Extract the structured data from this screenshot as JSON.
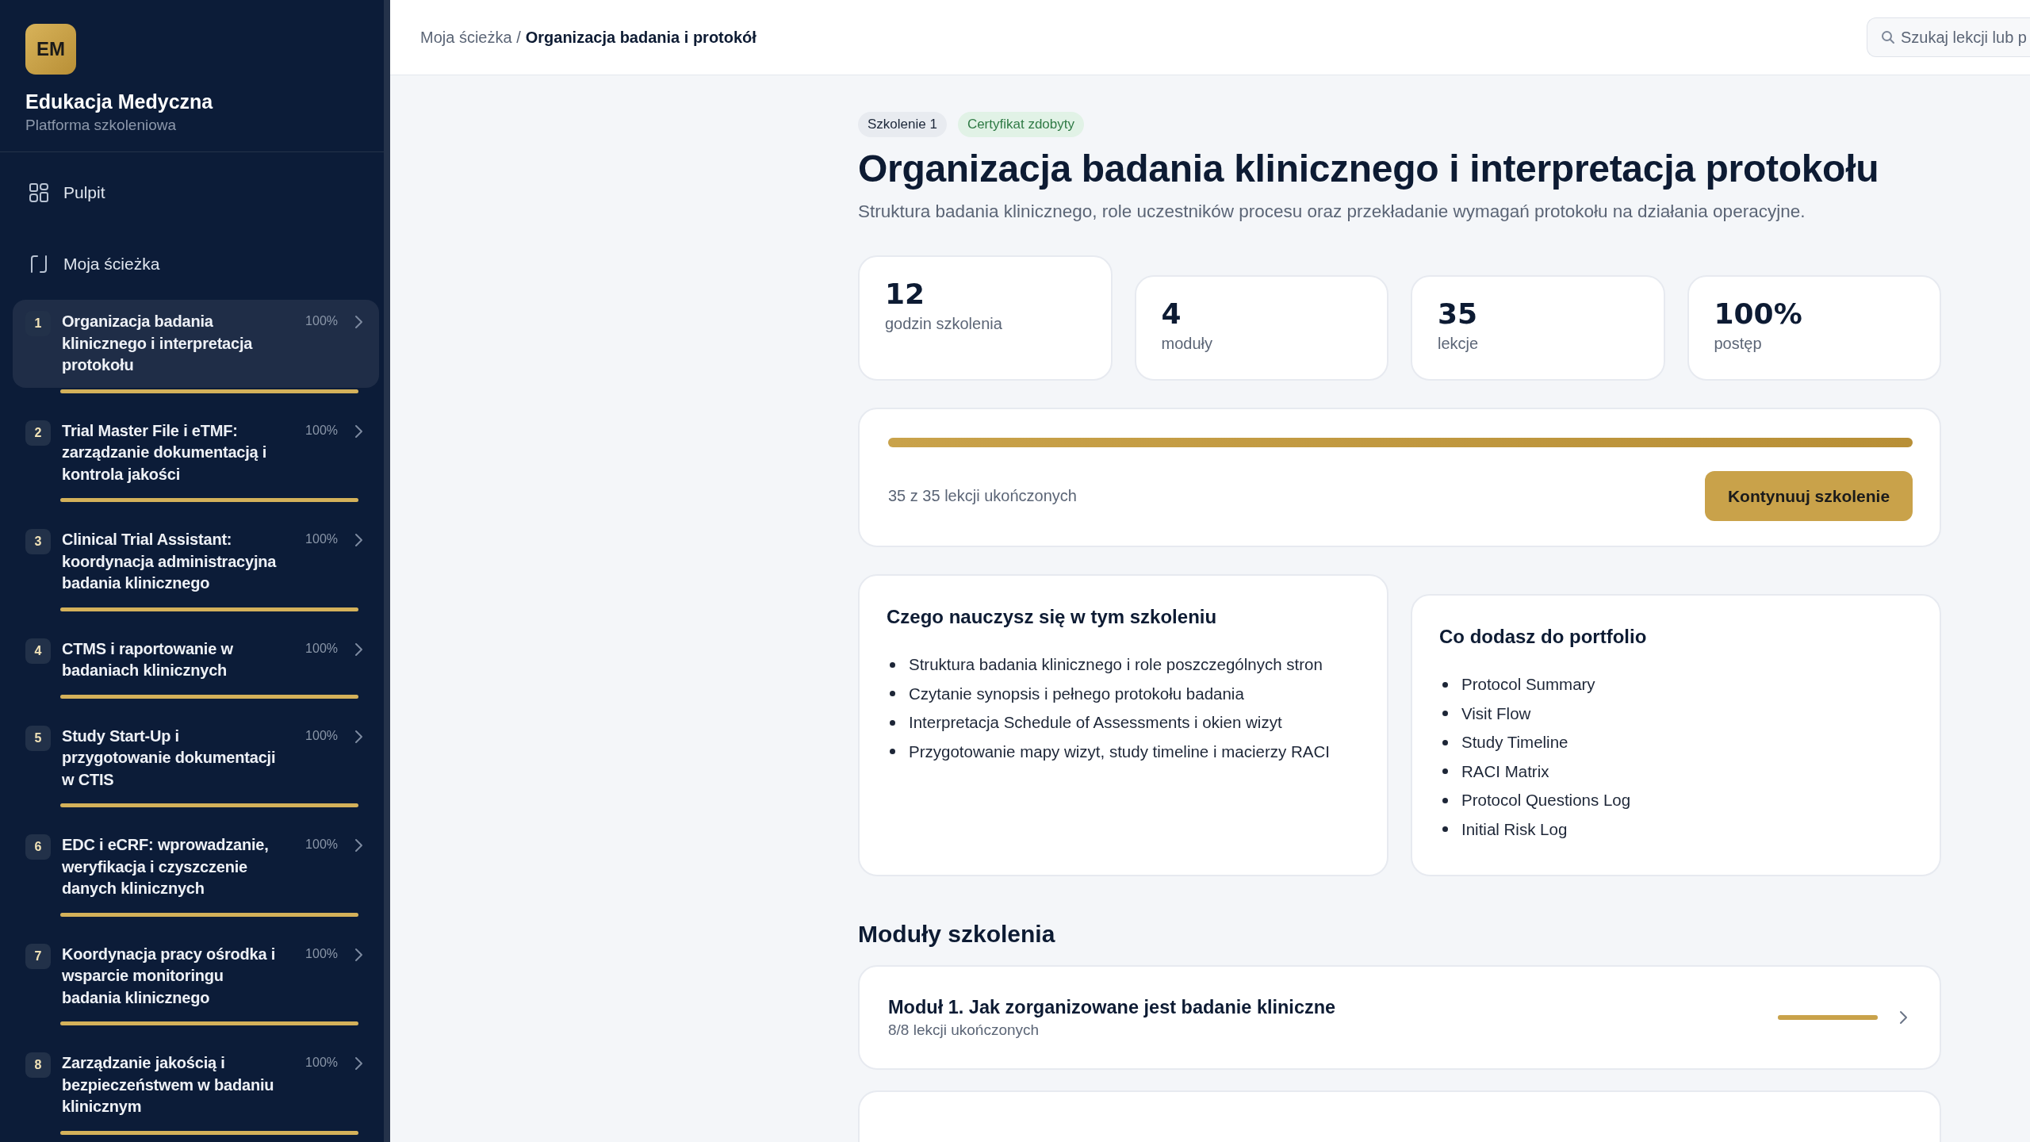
{
  "brand": {
    "logo": "EM",
    "name": "Edukacja Medyczna",
    "subtitle": "Platforma szkoleniowa"
  },
  "nav": [
    {
      "kind": "dashboard",
      "label": "Pulpit"
    },
    {
      "kind": "path",
      "label": "Moja ścieżka"
    }
  ],
  "courses": [
    {
      "number": "1",
      "title": "Organizacja badania klinicznego i interpretacja protokołu",
      "percent": "100%",
      "level": 1,
      "selected": true
    },
    {
      "number": "2",
      "title": "Trial Master File i eTMF: zarządzanie dokumentacją i kontrola jakości",
      "percent": "100%",
      "level": 1,
      "selected": false
    },
    {
      "number": "3",
      "title": "Clinical Trial Assistant: koordynacja administracyjna badania klinicznego",
      "percent": "100%",
      "level": 1,
      "selected": false
    },
    {
      "number": "4",
      "title": "CTMS i raportowanie w badaniach klinicznych",
      "percent": "100%",
      "level": 1,
      "selected": false
    },
    {
      "number": "5",
      "title": "Study Start-Up i przygotowanie dokumentacji w CTIS",
      "percent": "100%",
      "level": 1,
      "selected": false
    },
    {
      "number": "6",
      "title": "EDC i eCRF: wprowadzanie, weryfikacja i czyszczenie danych klinicznych",
      "percent": "100%",
      "level": 1,
      "selected": false
    },
    {
      "number": "7",
      "title": "Koordynacja pracy ośrodka i wsparcie monitoringu badania klinicznego",
      "percent": "100%",
      "level": 1,
      "selected": false
    },
    {
      "number": "8",
      "title": "Zarządzanie jakością i bezpieczeństwem w badaniu klinicznym",
      "percent": "100%",
      "level": 1,
      "selected": false
    }
  ],
  "breadcrumb": {
    "parent": "Moja ścieżka /",
    "current": "Organizacja badania i protokół"
  },
  "search": {
    "placeholder": "Szukaj lekcji lub p"
  },
  "tags": [
    {
      "kind": "neutral",
      "label": "Szkolenie 1"
    },
    {
      "kind": "success",
      "label": "Certyfikat zdobyty"
    }
  ],
  "title": "Organizacja badania klinicznego i interpretacja protokołu",
  "description": "Struktura badania klinicznego, role uczestników procesu oraz przekładanie wymagań protokołu na działania operacyjne.",
  "stats": [
    {
      "value": "12",
      "label": "godzin szkolenia"
    },
    {
      "value": "4",
      "label": "moduły"
    },
    {
      "value": "35",
      "label": "lekcje"
    },
    {
      "value": "100%",
      "label": "postęp"
    }
  ],
  "progress": {
    "level": 1,
    "caption": "35 z 35 lekcji ukończonych",
    "button": "Kontynuuj szkolenie"
  },
  "learn": {
    "heading": "Czego nauczysz się w tym szkoleniu",
    "items": [
      "Struktura badania klinicznego i role poszczególnych stron",
      "Czytanie synopsis i pełnego protokołu badania",
      "Interpretacja Schedule of Assessments i okien wizyt",
      "Przygotowanie mapy wizyt, study timeline i macierzy RACI"
    ]
  },
  "portfolio": {
    "heading": "Co dodasz do portfolio",
    "items": [
      "Protocol Summary",
      "Visit Flow",
      "Study Timeline",
      "RACI Matrix",
      "Protocol Questions Log",
      "Initial Risk Log"
    ]
  },
  "modules_heading": "Moduły szkolenia",
  "modules": [
    {
      "title": "Moduł 1. Jak zorganizowane jest badanie kliniczne",
      "caption": "8/8 lekcji ukończonych",
      "level": 1
    }
  ]
}
